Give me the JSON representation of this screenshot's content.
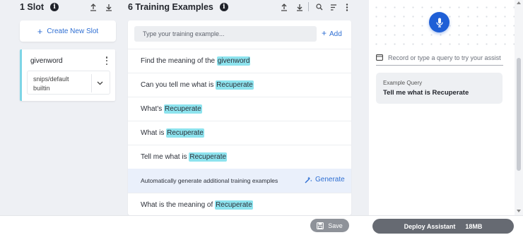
{
  "slots": {
    "title": "1 Slot",
    "create_label": "Create New Slot",
    "items": [
      {
        "name": "givenword",
        "type_line1": "snips/default",
        "type_line2": "builtin"
      }
    ]
  },
  "training": {
    "title": "6 Training Examples",
    "input_placeholder": "Type your training example...",
    "add_label": "Add",
    "examples": [
      {
        "before": "Find the meaning of the ",
        "slot": "givenword",
        "after": ""
      },
      {
        "before": "Can you tell me what is ",
        "slot": "Recuperate",
        "after": ""
      },
      {
        "before": "What's ",
        "slot": "Recuperate",
        "after": ""
      },
      {
        "before": "What is ",
        "slot": "Recuperate",
        "after": ""
      },
      {
        "before": "Tell me what is ",
        "slot": "Recuperate",
        "after": ""
      }
    ],
    "generate_text": "Automatically generate additional training examples",
    "generate_label": "Generate",
    "last_example": {
      "before": "What is the meaning of ",
      "slot": "Recuperate",
      "after": ""
    }
  },
  "tester": {
    "query_placeholder": "Record or type a query to try your assistant",
    "example_label": "Example Query",
    "example_value": "Tell me what is Recuperate"
  },
  "footer": {
    "save_label": "Save",
    "deploy_label": "Deploy Assistant",
    "deploy_size": "18MB"
  },
  "colors": {
    "accent": "#2f6fd3",
    "slot_highlight": "#8de3ee",
    "mic": "#1f5fd6"
  }
}
